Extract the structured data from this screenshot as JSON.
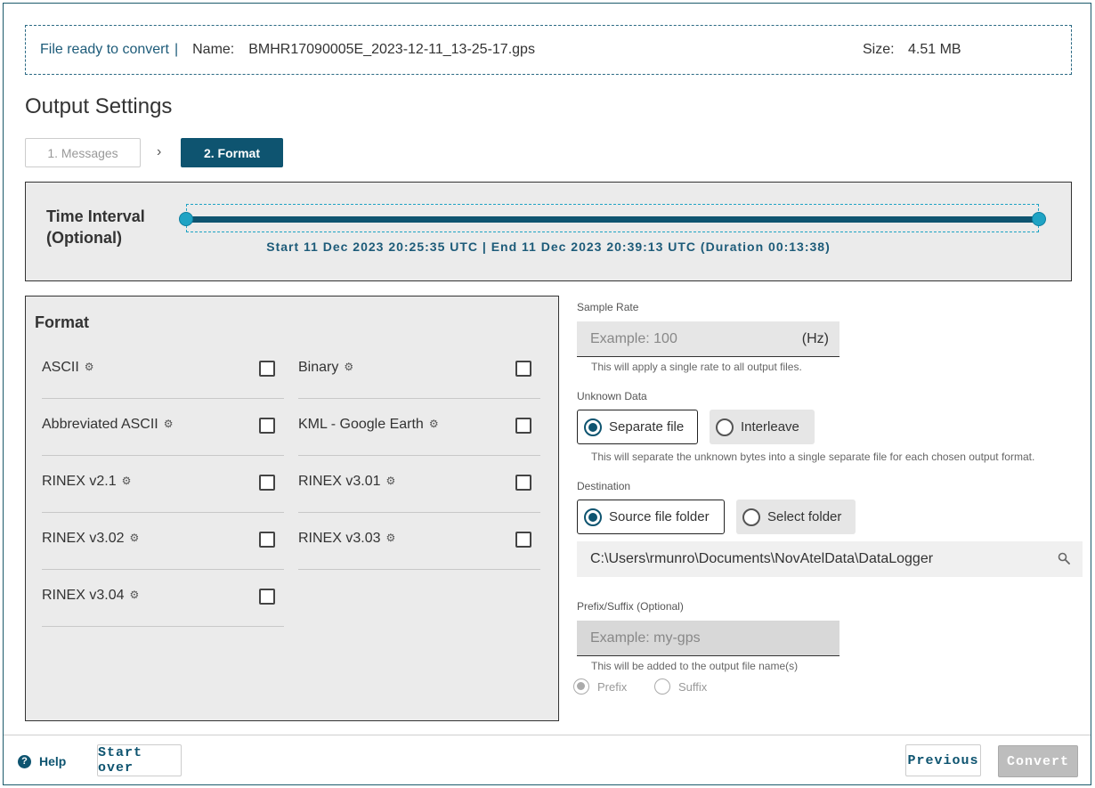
{
  "file_banner": {
    "status": "File ready to convert",
    "separator": "|",
    "name_label": "Name:",
    "name_value": "BMHR17090005E_2023-12-11_13-25-17.gps",
    "size_label": "Size:",
    "size_value": "4.51 MB"
  },
  "page_title": "Output Settings",
  "steps": [
    {
      "label": "1. Messages",
      "active": false
    },
    {
      "label": "2. Format",
      "active": true
    }
  ],
  "time_interval": {
    "label_line1": "Time Interval",
    "label_line2": "(Optional)",
    "range_text": "Start 11 Dec 2023 20:25:35 UTC | End 11 Dec 2023 20:39:13 UTC (Duration 00:13:38)",
    "selected_fraction_start": 0,
    "selected_fraction_end": 1
  },
  "format": {
    "title": "Format",
    "items": [
      {
        "label": "ASCII",
        "checked": false
      },
      {
        "label": "Binary",
        "checked": false
      },
      {
        "label": "Abbreviated ASCII",
        "checked": false
      },
      {
        "label": "KML - Google Earth",
        "checked": false
      },
      {
        "label": "RINEX v2.1",
        "checked": false
      },
      {
        "label": "RINEX v3.01",
        "checked": false
      },
      {
        "label": "RINEX v3.02",
        "checked": false
      },
      {
        "label": "RINEX v3.03",
        "checked": false
      },
      {
        "label": "RINEX v3.04",
        "checked": false
      }
    ],
    "gear_icon": "gear-icon"
  },
  "sample_rate": {
    "label": "Sample Rate",
    "placeholder": "Example: 100",
    "unit": "(Hz)",
    "hint": "This will apply a single rate to all output files."
  },
  "unknown_data": {
    "label": "Unknown Data",
    "options": [
      {
        "label": "Separate file",
        "selected": true
      },
      {
        "label": "Interleave",
        "selected": false
      }
    ],
    "hint": "This will separate the unknown bytes into a single separate file for each chosen output format."
  },
  "destination": {
    "label": "Destination",
    "options": [
      {
        "label": "Source file folder",
        "selected": true
      },
      {
        "label": "Select folder",
        "selected": false
      }
    ],
    "path": "C:\\Users\\rmunro\\Documents\\NovAtelData\\DataLogger"
  },
  "prefix_suffix": {
    "label": "Prefix/Suffix (Optional)",
    "placeholder": "Example: my-gps",
    "hint": "This will be added to the output file name(s)",
    "options": [
      {
        "label": "Prefix",
        "selected": true
      },
      {
        "label": "Suffix",
        "selected": false
      }
    ]
  },
  "footer": {
    "help_label": "Help",
    "start_over_label": "Start over",
    "previous_label": "Previous",
    "convert_label": "Convert"
  },
  "colors": {
    "accent": "#0e5470",
    "slider_knob": "#1fa3c4",
    "panel_bg": "#ebebeb"
  }
}
